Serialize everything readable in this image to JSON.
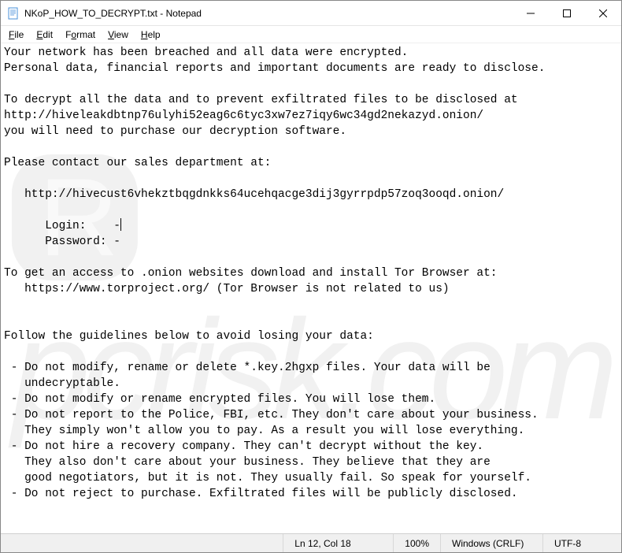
{
  "title": "NKoP_HOW_TO_DECRYPT.txt - Notepad",
  "menu": {
    "file": "File",
    "edit": "Edit",
    "format": "Format",
    "view": "View",
    "help": "Help"
  },
  "content": {
    "l1": "Your network has been breached and all data were encrypted.",
    "l2": "Personal data, financial reports and important documents are ready to disclose.",
    "l3": "",
    "l4": "To decrypt all the data and to prevent exfiltrated files to be disclosed at",
    "l5": "http://hiveleakdbtnp76ulyhi52eag6c6tyc3xw7ez7iqy6wc34gd2nekazyd.onion/",
    "l6": "you will need to purchase our decryption software.",
    "l7": "",
    "l8": "Please contact our sales department at:",
    "l9": "",
    "l10": "   http://hivecust6vhekztbqgdnkks64ucehqacge3dij3gyrrpdp57zoq3ooqd.onion/",
    "l11": "",
    "l12a": "      Login:    -",
    "l13": "      Password: -",
    "l14": "",
    "l15": "To get an access to .onion websites download and install Tor Browser at:",
    "l16": "   https://www.torproject.org/ (Tor Browser is not related to us)",
    "l17": "",
    "l18": "",
    "l19": "Follow the guidelines below to avoid losing your data:",
    "l20": "",
    "l21": " - Do not modify, rename or delete *.key.2hgxp files. Your data will be",
    "l22": "   undecryptable.",
    "l23": " - Do not modify or rename encrypted files. You will lose them.",
    "l24": " - Do not report to the Police, FBI, etc. They don't care about your business.",
    "l25": "   They simply won't allow you to pay. As a result you will lose everything.",
    "l26": " - Do not hire a recovery company. They can't decrypt without the key.",
    "l27": "   They also don't care about your business. They believe that they are",
    "l28": "   good negotiators, but it is not. They usually fail. So speak for yourself.",
    "l29": " - Do not reject to purchase. Exfiltrated files will be publicly disclosed."
  },
  "status": {
    "position": "Ln 12, Col 18",
    "zoom": "100%",
    "lineending": "Windows (CRLF)",
    "encoding": "UTF-8"
  },
  "watermark": "pcrisk.com"
}
